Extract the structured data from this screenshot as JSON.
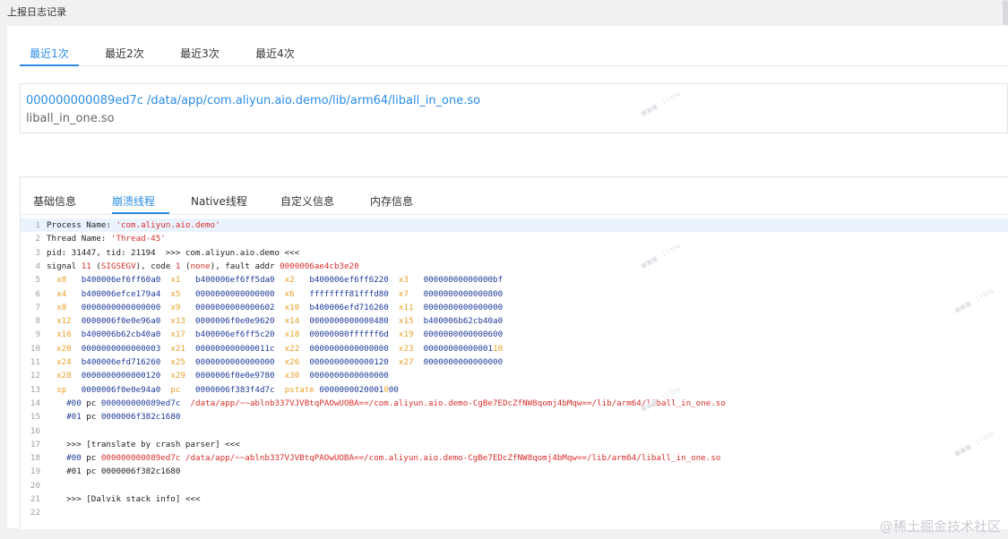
{
  "page": {
    "title": "上报日志记录"
  },
  "tabs_top": [
    {
      "label": "最近1次",
      "active": true
    },
    {
      "label": "最近2次",
      "active": false
    },
    {
      "label": "最近3次",
      "active": false
    },
    {
      "label": "最近4次",
      "active": false
    }
  ],
  "frame": {
    "link": "000000000089ed7c /data/app/com.aliyun.aio.demo/lib/arm64/liball_in_one.so",
    "module": "liball_in_one.so"
  },
  "tabs_inner": [
    {
      "label": "基础信息",
      "active": false
    },
    {
      "label": "崩溃线程",
      "active": true
    },
    {
      "label": "Native线程",
      "active": false
    },
    {
      "label": "自定义信息",
      "active": false
    },
    {
      "label": "内存信息",
      "active": false
    }
  ],
  "code_lines": [
    {
      "n": "1",
      "segs": [
        [
          "t",
          "Process Name: "
        ],
        [
          "s",
          "'com.aliyun.aio.demo'"
        ]
      ]
    },
    {
      "n": "2",
      "segs": [
        [
          "t",
          "Thread Name: "
        ],
        [
          "s",
          "'Thread-45'"
        ]
      ]
    },
    {
      "n": "3",
      "segs": [
        [
          "t",
          "pid: 31447, tid: 21194  >>> com.aliyun.aio.demo <<<"
        ]
      ]
    },
    {
      "n": "4",
      "segs": [
        [
          "t",
          "signal "
        ],
        [
          "s",
          "11"
        ],
        [
          "t",
          " ("
        ],
        [
          "s",
          "SIGSEGV"
        ],
        [
          "t",
          "), code "
        ],
        [
          "s",
          "1"
        ],
        [
          "t",
          " ("
        ],
        [
          "s",
          "none"
        ],
        [
          "t",
          "), fault addr "
        ],
        [
          "s",
          "0000006ae4cb3e20"
        ]
      ]
    },
    {
      "n": "5",
      "segs": [
        [
          "t",
          "  "
        ],
        [
          "r",
          "x0"
        ],
        [
          "t",
          "   "
        ],
        [
          "h",
          "b400006ef6ff60a0"
        ],
        [
          "t",
          "  "
        ],
        [
          "r",
          "x1"
        ],
        [
          "t",
          "   "
        ],
        [
          "h",
          "b400006ef6ff5da0"
        ],
        [
          "t",
          "  "
        ],
        [
          "r",
          "x2"
        ],
        [
          "t",
          "   "
        ],
        [
          "h",
          "b400006ef6ff6220"
        ],
        [
          "t",
          "  "
        ],
        [
          "r",
          "x3"
        ],
        [
          "t",
          "   "
        ],
        [
          "h",
          "00000000000000bf"
        ]
      ]
    },
    {
      "n": "6",
      "segs": [
        [
          "t",
          "  "
        ],
        [
          "r",
          "x4"
        ],
        [
          "t",
          "   "
        ],
        [
          "h",
          "b400006efce179a4"
        ],
        [
          "t",
          "  "
        ],
        [
          "r",
          "x5"
        ],
        [
          "t",
          "   "
        ],
        [
          "h",
          "0000000000000000"
        ],
        [
          "t",
          "  "
        ],
        [
          "r",
          "x6"
        ],
        [
          "t",
          "   "
        ],
        [
          "h",
          "ffffffff81fffd80"
        ],
        [
          "t",
          "  "
        ],
        [
          "r",
          "x7"
        ],
        [
          "t",
          "   "
        ],
        [
          "h",
          "0000000000000800"
        ]
      ]
    },
    {
      "n": "7",
      "segs": [
        [
          "t",
          "  "
        ],
        [
          "r",
          "x8"
        ],
        [
          "t",
          "   "
        ],
        [
          "h",
          "0000000000000000"
        ],
        [
          "t",
          "  "
        ],
        [
          "r",
          "x9"
        ],
        [
          "t",
          "   "
        ],
        [
          "h",
          "0000000000000602"
        ],
        [
          "t",
          "  "
        ],
        [
          "r",
          "x10"
        ],
        [
          "t",
          "  "
        ],
        [
          "h",
          "b400006efd716260"
        ],
        [
          "t",
          "  "
        ],
        [
          "r",
          "x11"
        ],
        [
          "t",
          "  "
        ],
        [
          "h",
          "0000000000000000"
        ]
      ]
    },
    {
      "n": "8",
      "segs": [
        [
          "t",
          "  "
        ],
        [
          "r",
          "x12"
        ],
        [
          "t",
          "  "
        ],
        [
          "h",
          "0000006f0e0e96a0"
        ],
        [
          "t",
          "  "
        ],
        [
          "r",
          "x13"
        ],
        [
          "t",
          "  "
        ],
        [
          "h",
          "0000006f0e0e9620"
        ],
        [
          "t",
          "  "
        ],
        [
          "r",
          "x14"
        ],
        [
          "t",
          "  "
        ],
        [
          "h",
          "0000000000000480"
        ],
        [
          "t",
          "  "
        ],
        [
          "r",
          "x15"
        ],
        [
          "t",
          "  "
        ],
        [
          "h",
          "b400006b62cb40a0"
        ]
      ]
    },
    {
      "n": "9",
      "segs": [
        [
          "t",
          "  "
        ],
        [
          "r",
          "x16"
        ],
        [
          "t",
          "  "
        ],
        [
          "h",
          "b400006b62cb40a0"
        ],
        [
          "t",
          "  "
        ],
        [
          "r",
          "x17"
        ],
        [
          "t",
          "  "
        ],
        [
          "h",
          "b400006ef6ff5c20"
        ],
        [
          "t",
          "  "
        ],
        [
          "r",
          "x18"
        ],
        [
          "t",
          "  "
        ],
        [
          "h",
          "00000000ffffff6d"
        ],
        [
          "t",
          "  "
        ],
        [
          "r",
          "x19"
        ],
        [
          "t",
          "  "
        ],
        [
          "h",
          "0000000000000600"
        ]
      ]
    },
    {
      "n": "10",
      "segs": [
        [
          "t",
          "  "
        ],
        [
          "r",
          "x20"
        ],
        [
          "t",
          "  "
        ],
        [
          "h",
          "0000000000000003"
        ],
        [
          "t",
          "  "
        ],
        [
          "r",
          "x21"
        ],
        [
          "t",
          "  "
        ],
        [
          "h",
          "000000000000011c"
        ],
        [
          "t",
          "  "
        ],
        [
          "r",
          "x22"
        ],
        [
          "t",
          "  "
        ],
        [
          "h",
          "0000000000000000"
        ],
        [
          "t",
          "  "
        ],
        [
          "r",
          "x23"
        ],
        [
          "t",
          "  "
        ],
        [
          "h",
          "00000000000001"
        ],
        [
          "r",
          "10"
        ]
      ]
    },
    {
      "n": "11",
      "segs": [
        [
          "t",
          "  "
        ],
        [
          "r",
          "x24"
        ],
        [
          "t",
          "  "
        ],
        [
          "h",
          "b400006efd716260"
        ],
        [
          "t",
          "  "
        ],
        [
          "r",
          "x25"
        ],
        [
          "t",
          "  "
        ],
        [
          "h",
          "0000000000000000"
        ],
        [
          "t",
          "  "
        ],
        [
          "r",
          "x26"
        ],
        [
          "t",
          "  "
        ],
        [
          "h",
          "0000000000000120"
        ],
        [
          "t",
          "  "
        ],
        [
          "r",
          "x27"
        ],
        [
          "t",
          "  "
        ],
        [
          "h",
          "0000000000000000"
        ]
      ]
    },
    {
      "n": "12",
      "segs": [
        [
          "t",
          "  "
        ],
        [
          "r",
          "x28"
        ],
        [
          "t",
          "  "
        ],
        [
          "h",
          "0000000000000120"
        ],
        [
          "t",
          "  "
        ],
        [
          "r",
          "x29"
        ],
        [
          "t",
          "  "
        ],
        [
          "h",
          "0000006f0e0e9780"
        ],
        [
          "t",
          "  "
        ],
        [
          "r",
          "x30"
        ],
        [
          "t",
          "  "
        ],
        [
          "h",
          "0000000000000000"
        ]
      ]
    },
    {
      "n": "13",
      "segs": [
        [
          "t",
          "  "
        ],
        [
          "r",
          "sp"
        ],
        [
          "t",
          "   "
        ],
        [
          "h",
          "0000006f0e0e94a0"
        ],
        [
          "t",
          "  "
        ],
        [
          "r",
          "pc"
        ],
        [
          "t",
          "   "
        ],
        [
          "h",
          "0000006f383f4d7c"
        ],
        [
          "t",
          "  "
        ],
        [
          "r",
          "pstate"
        ],
        [
          "t",
          " "
        ],
        [
          "h",
          "0000000020001"
        ],
        [
          "r",
          "0"
        ],
        [
          "h",
          "00"
        ]
      ]
    },
    {
      "n": "14",
      "segs": [
        [
          "t",
          "    "
        ],
        [
          "h",
          "#00"
        ],
        [
          "t",
          " pc "
        ],
        [
          "h",
          "000000000089ed7c"
        ],
        [
          "t",
          "  "
        ],
        [
          "s",
          "/data/app/~~ablnb337VJVBtqPAOwUOBA==/com.aliyun.aio.demo-CgBe7EDcZfNW8qomj4bMqw==/lib/arm64/liball_in_one.so"
        ]
      ]
    },
    {
      "n": "15",
      "segs": [
        [
          "t",
          "    "
        ],
        [
          "h",
          "#01"
        ],
        [
          "t",
          " pc "
        ],
        [
          "h",
          "0000006f382c1680"
        ]
      ]
    },
    {
      "n": "16",
      "segs": []
    },
    {
      "n": "17",
      "segs": [
        [
          "t",
          "    >>> [translate by crash parser] <<<"
        ]
      ]
    },
    {
      "n": "18",
      "segs": [
        [
          "t",
          "    "
        ],
        [
          "h",
          "#00"
        ],
        [
          "t",
          " pc "
        ],
        [
          "s",
          "000000000089ed7c /data/app/~~ablnb337VJVBtqPAOwUOBA==/com.aliyun.aio.demo-CgBe7EDcZfNW8qomj4bMqw==/lib/arm64/liball_in_one.so"
        ]
      ]
    },
    {
      "n": "19",
      "segs": [
        [
          "t",
          "    #01 pc 0000006f382c1680"
        ]
      ]
    },
    {
      "n": "20",
      "segs": []
    },
    {
      "n": "21",
      "segs": [
        [
          "t",
          "    >>> [Dalvik stack info] <<<"
        ]
      ]
    },
    {
      "n": "22",
      "segs": []
    }
  ],
  "watermark": {
    "text": "@稀土掘金技术社区"
  },
  "colors": {
    "accent": "#2a8ce8",
    "string": "#d9302c",
    "register": "#e8a028",
    "hex": "#1d3a9a"
  }
}
